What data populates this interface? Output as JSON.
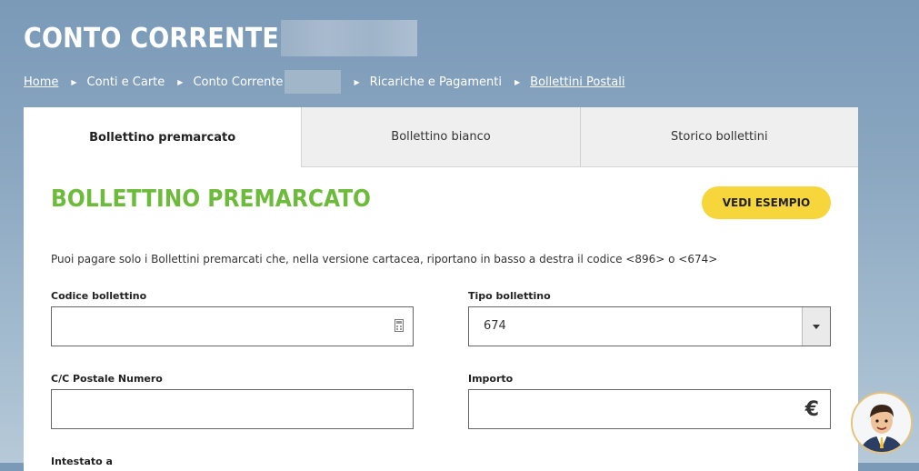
{
  "header": {
    "title": "CONTO CORRENTE"
  },
  "breadcrumb": {
    "items": [
      "Home",
      "Conti e Carte",
      "Conto Corrente",
      "Ricariche e Pagamenti",
      "Bollettini Postali"
    ]
  },
  "tabs": [
    "Bollettino premarcato",
    "Bollettino bianco",
    "Storico bollettini"
  ],
  "form": {
    "title": "BOLLETTINO PREMARCATO",
    "example_button": "VEDI ESEMPIO",
    "intro": "Puoi pagare solo i Bollettini premarcati che, nella versione cartacea, riportano in basso a destra il codice <896> o <674>",
    "codice_label": "Codice bollettino",
    "codice_value": "",
    "tipo_label": "Tipo bollettino",
    "tipo_value": "674",
    "cc_label": "C/C Postale Numero",
    "cc_value": "",
    "importo_label": "Importo",
    "importo_value": "",
    "currency_symbol": "€",
    "intestato_label": "Intestato a"
  },
  "colors": {
    "accent_green": "#6dbb3a",
    "button_yellow": "#f7d63c",
    "header_bg": "#7a9ab8"
  },
  "icons": [
    "calculator-icon",
    "dropdown-caret-icon",
    "euro-icon",
    "chevron-right-icon",
    "assistant-avatar-icon"
  ]
}
